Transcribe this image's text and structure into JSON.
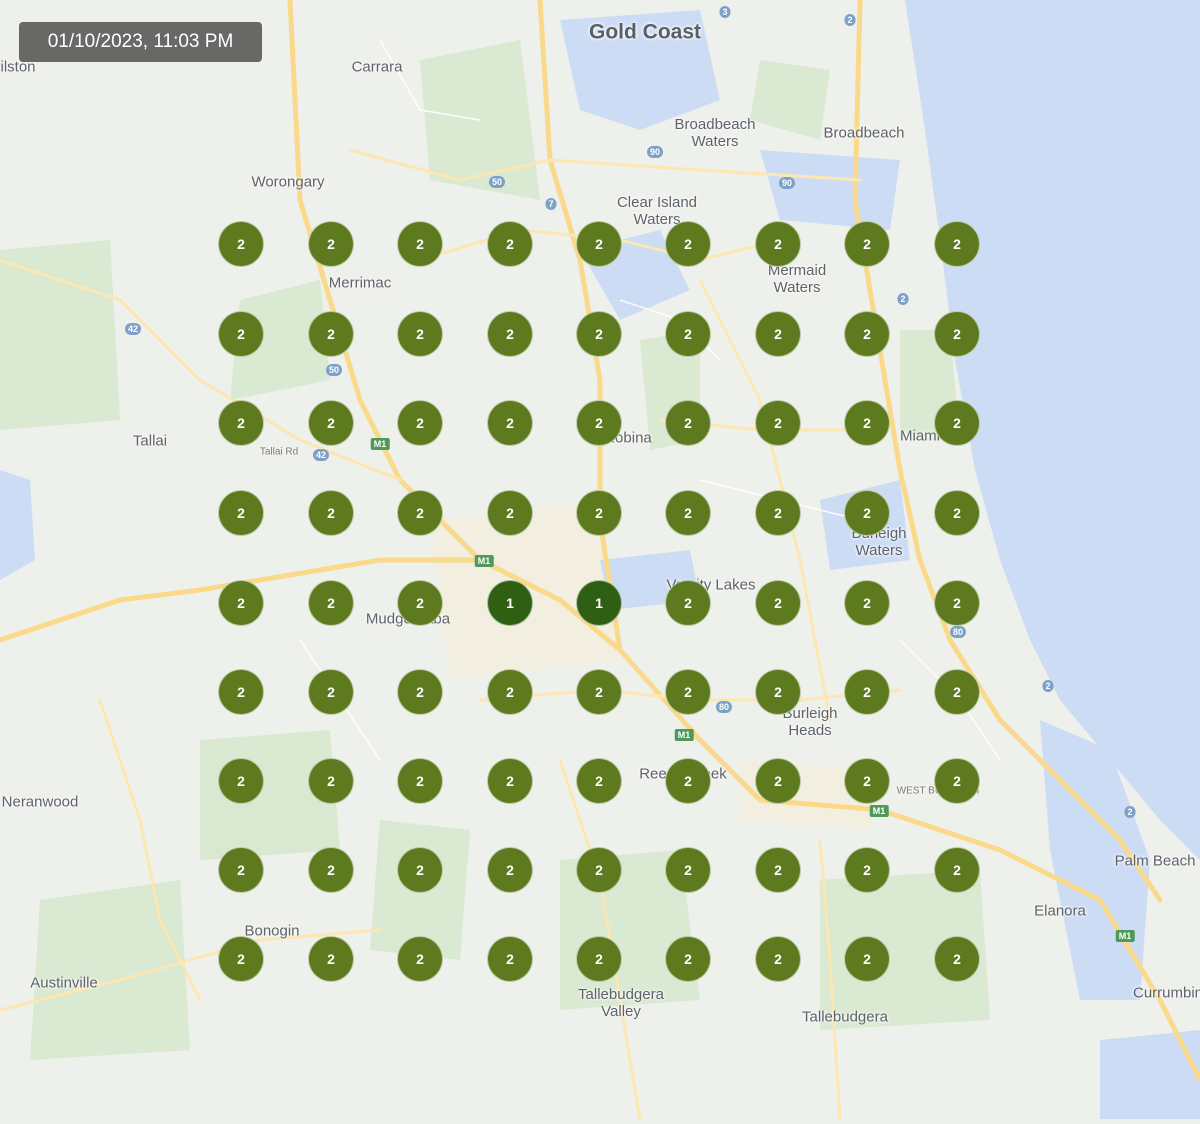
{
  "timestamp": "01/10/2023, 11:03 PM",
  "colors": {
    "marker": "#5d7a1f",
    "marker_low": "#2f5f12",
    "water": "#cddcf5",
    "land": "#eef0ec",
    "green": "#d6e8cf",
    "road": "#fbd98a"
  },
  "places": [
    {
      "name": "Gold Coast",
      "cls": "big"
    },
    {
      "name": "Carrara"
    },
    {
      "name": "Broadbeach\nWaters"
    },
    {
      "name": "Broadbeach"
    },
    {
      "name": "Worongary"
    },
    {
      "name": "Clear Island\nWaters"
    },
    {
      "name": "Merrimac"
    },
    {
      "name": "Mermaid\nWaters"
    },
    {
      "name": "Tallai"
    },
    {
      "name": "Tallai Rd",
      "cls": "small"
    },
    {
      "name": "Mudgeeraba"
    },
    {
      "name": "Burleigh\nWaters"
    },
    {
      "name": "Varsity Lakes"
    },
    {
      "name": "Burleigh\nHeads"
    },
    {
      "name": "Reedy Creek"
    },
    {
      "name": "WEST BURLEIGH",
      "cls": "small"
    },
    {
      "name": "Neranwood"
    },
    {
      "name": "Palm Beach"
    },
    {
      "name": "Elanora"
    },
    {
      "name": "Bonogin"
    },
    {
      "name": "Austinville"
    },
    {
      "name": "Tallebudgera\nValley"
    },
    {
      "name": "Tallebudgera"
    },
    {
      "name": "Currumbin"
    },
    {
      "name": "ilston"
    },
    {
      "name": "Robina"
    },
    {
      "name": "Miami"
    }
  ],
  "road_shields": [
    "2",
    "3",
    "90",
    "90",
    "50",
    "7",
    "42",
    "50",
    "M1",
    "42",
    "M1",
    "M1",
    "80",
    "80",
    "2",
    "2",
    "2",
    "M1",
    "M1"
  ],
  "clusters": [
    [
      2,
      2,
      2,
      2,
      2,
      2,
      2,
      2,
      2
    ],
    [
      2,
      2,
      2,
      2,
      2,
      2,
      2,
      2,
      2
    ],
    [
      2,
      2,
      2,
      2,
      2,
      2,
      2,
      2,
      2
    ],
    [
      2,
      2,
      2,
      2,
      2,
      2,
      2,
      2,
      2
    ],
    [
      2,
      2,
      2,
      1,
      1,
      2,
      2,
      2,
      2
    ],
    [
      2,
      2,
      2,
      2,
      2,
      2,
      2,
      2,
      2
    ],
    [
      2,
      2,
      2,
      2,
      2,
      2,
      2,
      2,
      2
    ],
    [
      2,
      2,
      2,
      2,
      2,
      2,
      2,
      2,
      2
    ],
    [
      2,
      2,
      2,
      2,
      2,
      2,
      2,
      2,
      2
    ]
  ]
}
